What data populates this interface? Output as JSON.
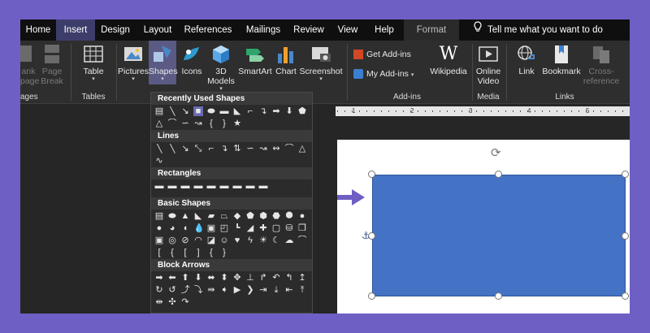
{
  "tabs": [
    "Home",
    "Insert",
    "Design",
    "Layout",
    "References",
    "Mailings",
    "Review",
    "View",
    "Help",
    "Format"
  ],
  "tell_me": "Tell me what you want to do",
  "ribbon": {
    "blank_page": "ank\npage",
    "page_break": "Page\nBreak",
    "table": "Table",
    "pictures": "Pictures",
    "shapes": "Shapes",
    "icons": "Icons",
    "models_3d": "3D\nModels",
    "smartart": "SmartArt",
    "chart": "Chart",
    "screenshot": "Screenshot",
    "get_addins": "Get Add-ins",
    "my_addins": "My Add-ins",
    "wikipedia": "Wikipedia",
    "online_video": "Online\nVideo",
    "link": "Link",
    "bookmark": "Bookmark",
    "cross_reference": "Cross-\nreference"
  },
  "groups": {
    "pages": "ages",
    "tables": "Tables",
    "addins": "Add-ins",
    "media": "Media",
    "links": "Links"
  },
  "gallery": {
    "recent": "Recently Used Shapes",
    "lines": "Lines",
    "rectangles": "Rectangles",
    "basic": "Basic Shapes",
    "block_arrows": "Block Arrows"
  },
  "ruler_numbers": [
    "1",
    "2",
    "3",
    "4",
    "5"
  ],
  "colors": {
    "shape_fill": "#4472c4",
    "accent": "#6e5fc4",
    "active_tab": "#3d3d6b"
  }
}
